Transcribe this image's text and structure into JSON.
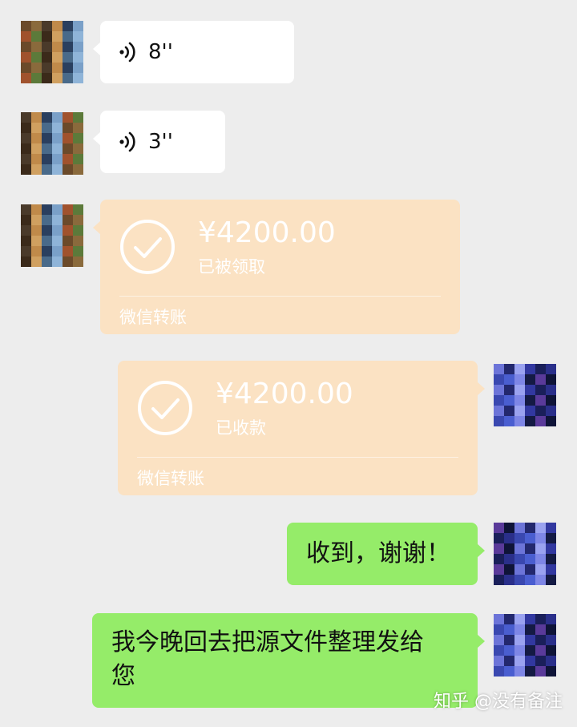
{
  "messages": [
    {
      "type": "voice",
      "side": "left",
      "duration": "8''"
    },
    {
      "type": "voice",
      "side": "left",
      "duration": "3''"
    },
    {
      "type": "transfer",
      "side": "left",
      "amount": "¥4200.00",
      "status": "已被领取",
      "label": "微信转账"
    },
    {
      "type": "transfer",
      "side": "right",
      "amount": "¥4200.00",
      "status": "已收款",
      "label": "微信转账"
    },
    {
      "type": "text",
      "side": "right",
      "text": "收到，谢谢！"
    },
    {
      "type": "text",
      "side": "right",
      "text_line1": "我今晚回去把源文件整理发给",
      "text_line2": "您"
    }
  ],
  "watermark": "知乎 @没有备注",
  "colors": {
    "background": "#ededed",
    "sent_bubble": "#95ec69",
    "received_bubble": "#ffffff",
    "transfer_bubble": "#fbe2c3"
  },
  "icons": {
    "voice": "voice-wave-icon",
    "transfer_done": "check-circle-icon"
  }
}
